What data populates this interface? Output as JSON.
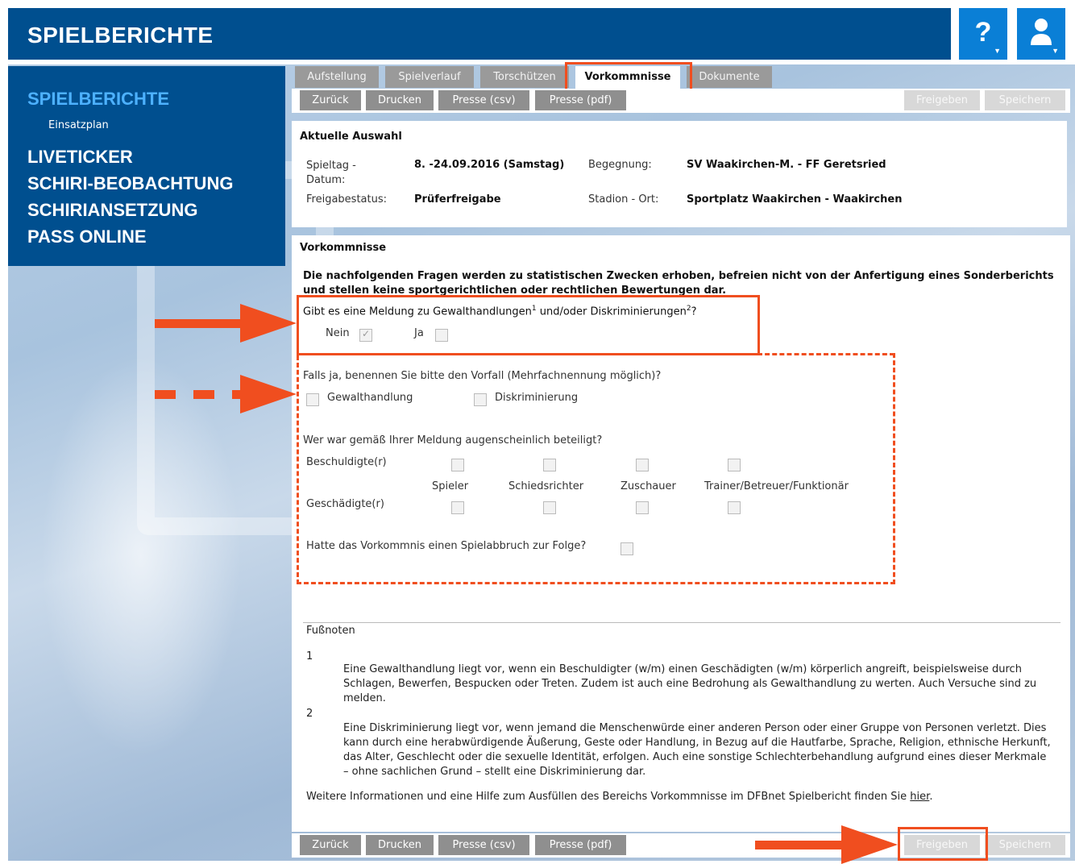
{
  "header": {
    "title": "SPIELBERICHTE",
    "help_label": "?",
    "user_icon": "user-icon"
  },
  "sidebar": {
    "active": "SPIELBERICHTE",
    "sub": "Einsatzplan",
    "items": [
      "LIVETICKER",
      "SCHIRI-BEOBACHTUNG",
      "SCHIRIANSETZUNG",
      "PASS ONLINE"
    ]
  },
  "tabs": [
    "Aufstellung",
    "Spielverlauf",
    "Torschützen",
    "Vorkommnisse",
    "Dokumente"
  ],
  "toolbar": {
    "buttons": [
      "Zurück",
      "Drucken",
      "Presse (csv)",
      "Presse (pdf)"
    ],
    "disabled": [
      "Freigeben",
      "Speichern"
    ]
  },
  "selection": {
    "title": "Aktuelle Auswahl",
    "spieltag_label": "Spieltag - Datum:",
    "spieltag_value": "8. -24.09.2016 (Samstag)",
    "begegnung_label": "Begegnung:",
    "begegnung_value": "SV Waakirchen-M. - FF Geretsried",
    "freigabe_label": "Freigabestatus:",
    "freigabe_value": "Prüferfreigabe",
    "stadion_label": "Stadion - Ort:",
    "stadion_value": "Sportplatz Waakirchen - Waakirchen"
  },
  "incidents": {
    "title": "Vorkommnisse",
    "intro": "Die nachfolgenden Fragen werden zu statistischen Zwecken erhoben, befreien nicht von der Anfertigung eines Sonderberichts und stellen keine sportgerichtlichen oder rechtlichen Bewertungen dar.",
    "q1_a": "Gibt es eine Meldung zu Gewalthandlungen",
    "q1_b": " und/oder Diskriminierungen",
    "q1_c": "?",
    "sup1": "1",
    "sup2": "2",
    "nein": "Nein",
    "ja": "Ja",
    "nein_checked": true,
    "q2": "Falls ja, benennen Sie bitte den Vorfall (Mehrfachnennung möglich)?",
    "opt_gewalt": "Gewalthandlung",
    "opt_diskr": "Diskriminierung",
    "q3": "Wer war gemäß Ihrer Meldung augenscheinlich beteiligt?",
    "row_beschuldigte": "Beschuldigte(r)",
    "row_geschaedigte": "Geschädigte(r)",
    "columns": [
      "Spieler",
      "Schiedsrichter",
      "Zuschauer",
      "Trainer/Betreuer/Funktionär"
    ],
    "q4": "Hatte das Vorkommnis einen Spielabbruch zur Folge?"
  },
  "footnotes": {
    "title": "Fußnoten",
    "n1": "1",
    "t1": "Eine Gewalthandlung liegt vor, wenn ein Beschuldigter (w/m) einen Geschädigten (w/m) körperlich angreift, beispielsweise durch Schlagen, Bewerfen, Bespucken oder Treten. Zudem ist auch eine Bedrohung als Gewalthandlung zu werten. Auch Versuche sind zu melden.",
    "n2": "2",
    "t2": "Eine Diskriminierung liegt vor, wenn jemand die Menschenwürde einer anderen Person oder einer Gruppe von Personen verletzt. Dies kann durch eine herabwürdigende Äußerung, Geste oder Handlung, in Bezug auf die Hautfarbe, Sprache, Religion, ethnische Herkunft, das Alter, Geschlecht oder die sexuelle Identität, erfolgen. Auch eine sonstige Schlechterbehandlung aufgrund eines dieser Merkmale – ohne sachlichen Grund – stellt eine Diskriminierung dar.",
    "more": "Weitere Informationen und eine Hilfe zum Ausfüllen des Bereichs Vorkommnisse im DFBnet Spielbericht finden Sie ",
    "link": "hier",
    "dot": "."
  },
  "colors": {
    "header_bg": "#004f8f",
    "accent_blue": "#0a7fd6",
    "highlight": "#f04e1f",
    "tab_bg": "#9a9a9a"
  }
}
